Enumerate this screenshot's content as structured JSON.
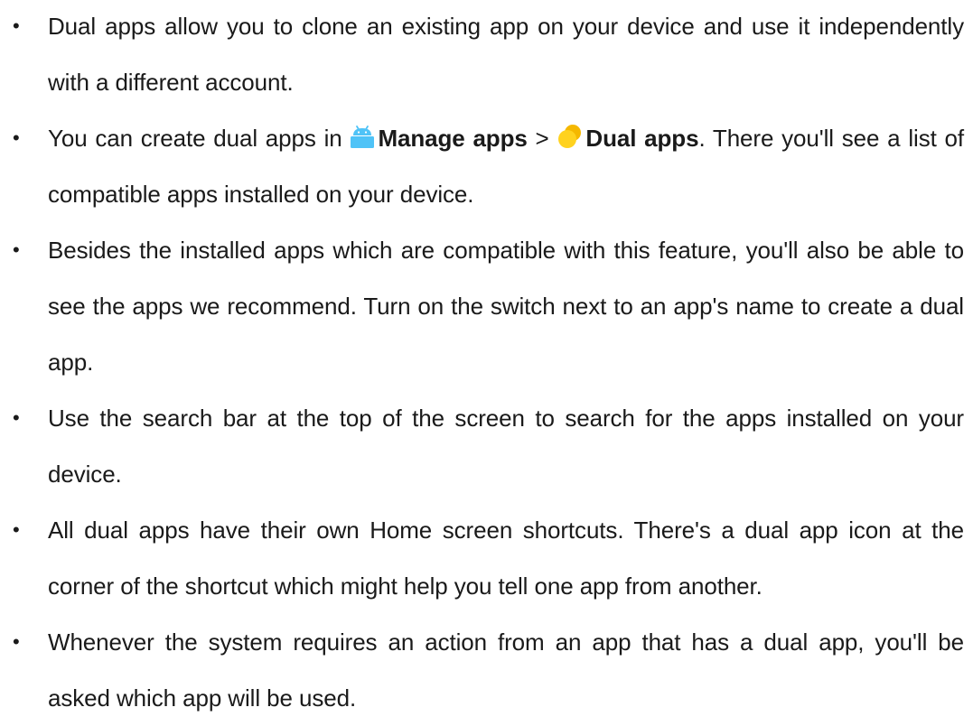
{
  "items": [
    {
      "text": "Dual apps allow you to clone an existing app on your device and use it independently with a different account."
    },
    {
      "prefix": "You can create dual apps in ",
      "link1_label": "Manage apps",
      "separator": " > ",
      "link2_label": "Dual apps",
      "suffix": ". There you'll see a list of compatible apps installed on your device."
    },
    {
      "text": "Besides the installed apps which are compatible with this feature, you'll also be able to see the apps we recommend. Turn on the switch next to an app's name to create a dual app."
    },
    {
      "text": "Use the search bar at the top of the screen to search for the apps installed on your device."
    },
    {
      "text": "All dual apps have their own Home screen shortcuts. There's a dual app icon at the corner of the shortcut which might help you tell one app from another."
    },
    {
      "text": "Whenever the system requires an action from an app that has a dual app, you'll be asked which app will be used."
    }
  ],
  "bullet_symbol": "•",
  "colors": {
    "manage_icon": "#4fc3f7",
    "dual_icon_primary": "#ffd21f",
    "dual_icon_secondary": "#f5b800"
  },
  "icons": {
    "manage_apps": "android-icon",
    "dual_apps": "dual-circles-icon"
  }
}
